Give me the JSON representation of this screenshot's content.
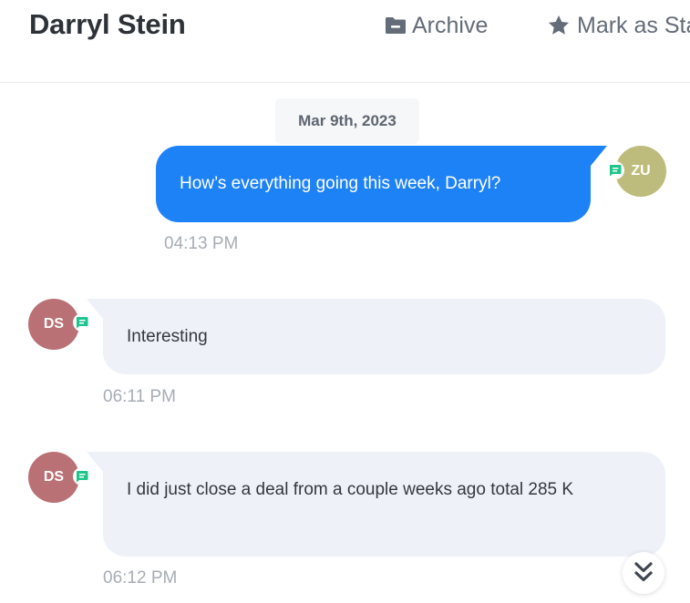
{
  "header": {
    "contact_name": "Darryl Stein",
    "archive_label": "Archive",
    "star_label": "Mark as Starred",
    "archive_icon": "folder-minus-icon",
    "star_icon": "star-icon"
  },
  "conversation": {
    "date_label": "Mar 9th, 2023",
    "messages": [
      {
        "direction": "outgoing",
        "avatar_initials": "ZU",
        "avatar_color": "#bdbc7c",
        "channel_icon": "sms-icon",
        "text": "How’s everything going this week, Darryl?",
        "time": "04:13 PM"
      },
      {
        "direction": "incoming",
        "avatar_initials": "DS",
        "avatar_color": "#b97176",
        "channel_icon": "sms-icon",
        "text": "Interesting",
        "time": "06:11 PM"
      },
      {
        "direction": "incoming",
        "avatar_initials": "DS",
        "avatar_color": "#b97176",
        "channel_icon": "sms-icon",
        "text": "I did just close a deal from a couple weeks ago total 285 K",
        "time": "06:12 PM"
      }
    ]
  },
  "scroll_button_icon": "chevrons-down-icon",
  "colors": {
    "outgoing_bubble": "#1e82f7",
    "incoming_bubble": "#eef1f8",
    "channel_badge": "#1ec58b"
  }
}
